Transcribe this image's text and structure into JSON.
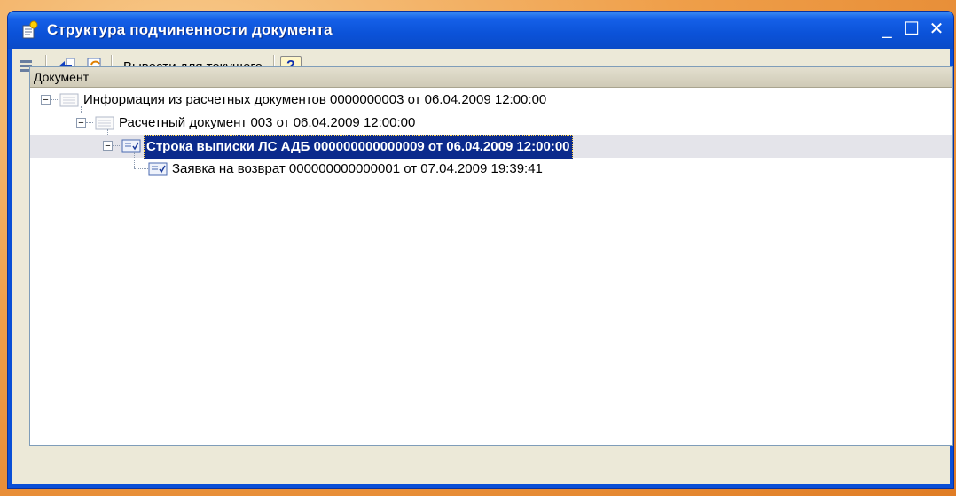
{
  "window": {
    "title": "Структура подчиненности документа"
  },
  "toolbar": {
    "output_current_label": "Вывести для текущего",
    "help_label": "?"
  },
  "grid": {
    "column_header": "Документ",
    "rows": [
      {
        "text": "Информация из расчетных документов 0000000003 от 06.04.2009 12:00:00",
        "level": 0,
        "expanded": true,
        "selected": false
      },
      {
        "text": "Расчетный документ 003 от 06.04.2009 12:00:00",
        "level": 1,
        "expanded": true,
        "selected": false
      },
      {
        "text": "Строка выписки ЛС АДБ 000000000000009 от 06.04.2009 12:00:00",
        "level": 2,
        "expanded": true,
        "selected": true
      },
      {
        "text": "Заявка на возврат 000000000000001 от 07.04.2009 19:39:41",
        "level": 3,
        "expanded": false,
        "selected": false
      }
    ]
  },
  "colors": {
    "titlebar": "#0b52d8",
    "selection": "#0b2a8c",
    "background_orange": "#ef9f4a"
  }
}
